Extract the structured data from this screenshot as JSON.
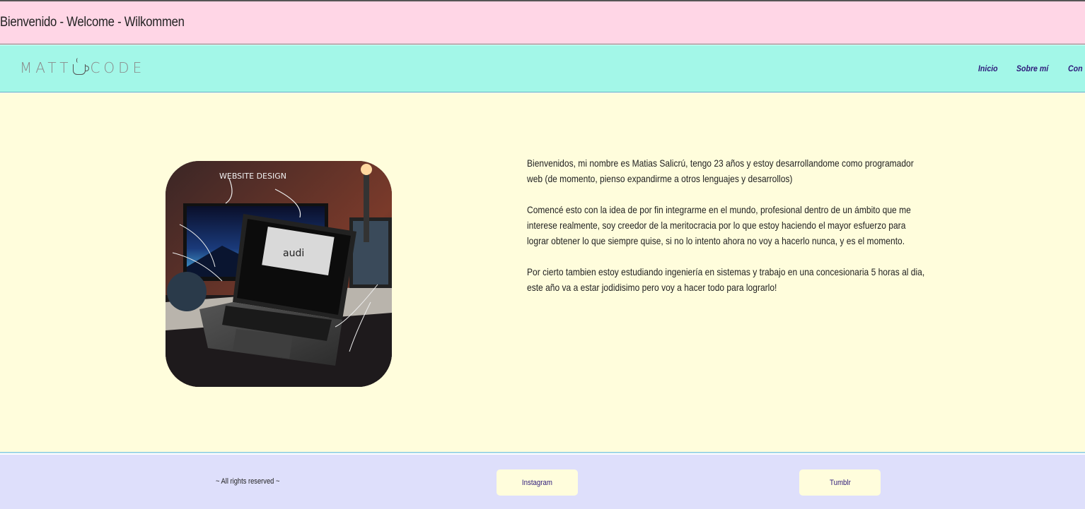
{
  "header": {
    "title": "Bienvenido - Welcome - Wilkommen"
  },
  "nav": {
    "logo_left": "MATT",
    "logo_right": "CODE",
    "logo_icon": "coffee-cup-icon",
    "links": [
      "Inicio",
      "Sobre mí",
      "Con"
    ]
  },
  "main": {
    "image": {
      "caption": "WEBSITE DESIGN",
      "screen_text": "audi"
    },
    "paragraphs": [
      "Bienvenidos, mi nombre es Matias Salicrú, tengo 23 años y estoy desarrollandome como programador web (de momento, pienso expandirme a otros lenguajes y desarrollos)",
      "Comencé esto con la idea de por fin integrarme en el mundo, profesional dentro de un ámbito que me interese realmente, soy creedor de la meritocracia por lo que estoy haciendo el mayor esfuerzo para lograr obtener lo que siempre quise, si no lo intento ahora no voy a hacerlo nunca, y es el momento.",
      "Por cierto tambien estoy estudiando ingeniería en sistemas y trabajo en una concesionaria 5 horas al dia, este año va a estar jodidisimo pero voy a hacer todo para lograrlo!"
    ]
  },
  "footer": {
    "rights": "~ All rights reserved ~",
    "instagram": "Instagram",
    "tumblr": "Tumblr"
  },
  "colors": {
    "header_bg": "#ffd6e6",
    "nav_bg": "#a3f7e8",
    "main_bg": "#fffddc",
    "footer_bg": "#dedffb",
    "link_color": "#2e1a7a"
  }
}
